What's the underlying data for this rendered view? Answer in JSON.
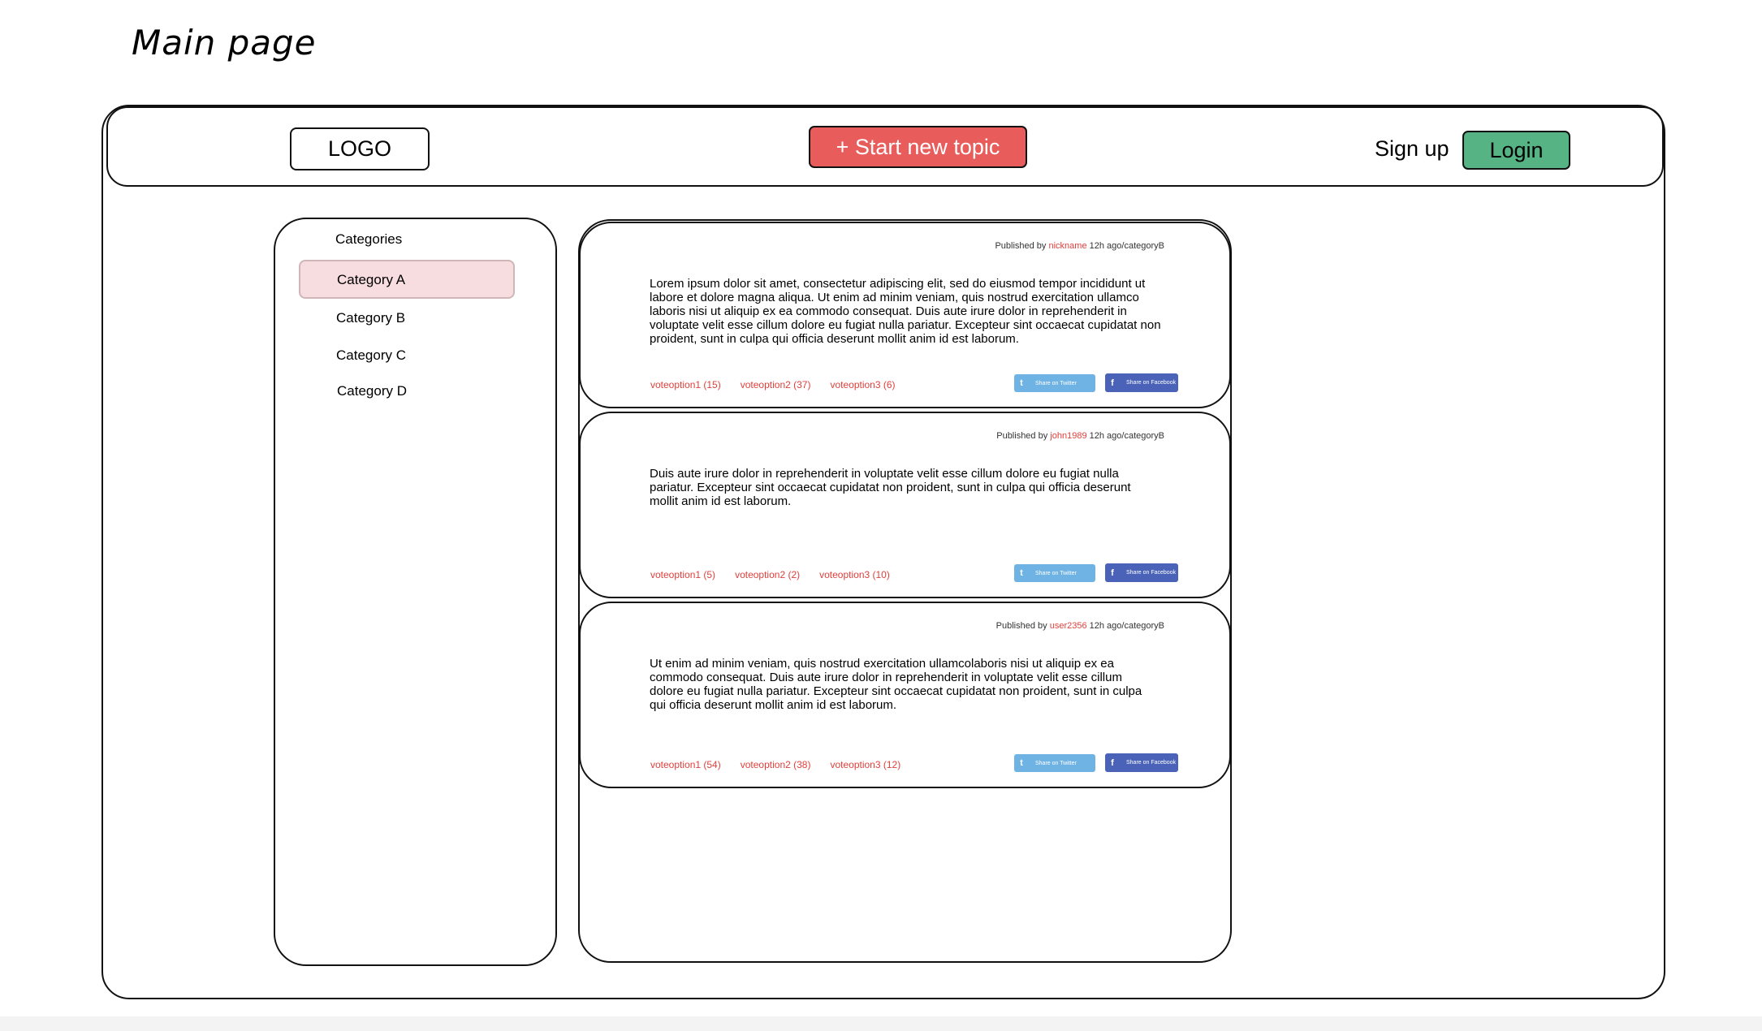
{
  "page_title": "Main page",
  "header": {
    "logo": "LOGO",
    "start_topic": "+ Start new topic",
    "signup": "Sign up",
    "login": "Login"
  },
  "sidebar": {
    "title": "Categories",
    "items": [
      {
        "label": "Category A",
        "active": true
      },
      {
        "label": "Category B",
        "active": false
      },
      {
        "label": "Category C",
        "active": false
      },
      {
        "label": "Category D",
        "active": false
      }
    ]
  },
  "posts": [
    {
      "published_prefix": "Published by",
      "author": "nickname",
      "meta_suffix": "12h ago/categoryB",
      "body": "Lorem ipsum dolor sit amet, consectetur adipiscing elit, sed do eiusmod tempor incididunt ut labore et dolore magna aliqua. Ut enim ad minim veniam, quis nostrud exercitation ullamco laboris nisi ut aliquip ex ea commodo consequat. Duis aute irure dolor in reprehenderit in voluptate velit esse cillum dolore eu fugiat nulla pariatur. Excepteur sint occaecat cupidatat non proident, sunt in culpa qui officia deserunt mollit anim id est laborum.",
      "votes": [
        "voteoption1 (15)",
        "voteoption2 (37)",
        "voteoption3 (6)"
      ],
      "twitter": "Share on Twitter",
      "facebook": "Share on Facebook"
    },
    {
      "published_prefix": "Published by",
      "author": "john1989",
      "meta_suffix": "12h ago/categoryB",
      "body": "Duis aute irure dolor in reprehenderit in voluptate velit esse cillum dolore eu fugiat nulla pariatur. Excepteur sint occaecat cupidatat non proident, sunt in culpa qui officia deserunt mollit anim id est laborum.",
      "votes": [
        "voteoption1 (5)",
        "voteoption2 (2)",
        "voteoption3 (10)"
      ],
      "twitter": "Share on Twitter",
      "facebook": "Share on Facebook"
    },
    {
      "published_prefix": "Published by",
      "author": "user2356",
      "meta_suffix": "12h ago/categoryB",
      "body": "Ut enim ad minim veniam, quis nostrud exercitation ullamcolaboris nisi ut aliquip ex ea commodo consequat. Duis aute irure dolor in reprehenderit in voluptate velit esse cillum dolore eu fugiat nulla pariatur. Excepteur sint occaecat cupidatat non proident, sunt in culpa qui officia deserunt mollit anim id est laborum.",
      "votes": [
        "voteoption1 (54)",
        "voteoption2 (38)",
        "voteoption3 (12)"
      ],
      "twitter": "Share on Twitter",
      "facebook": "Share on Facebook"
    }
  ],
  "colors": {
    "start_button": "#e85c5c",
    "login_button": "#56b383",
    "active_category": "#f8dde0",
    "accent_text": "#e0403c",
    "twitter": "#6fb3e4",
    "facebook": "#4a63b8"
  }
}
